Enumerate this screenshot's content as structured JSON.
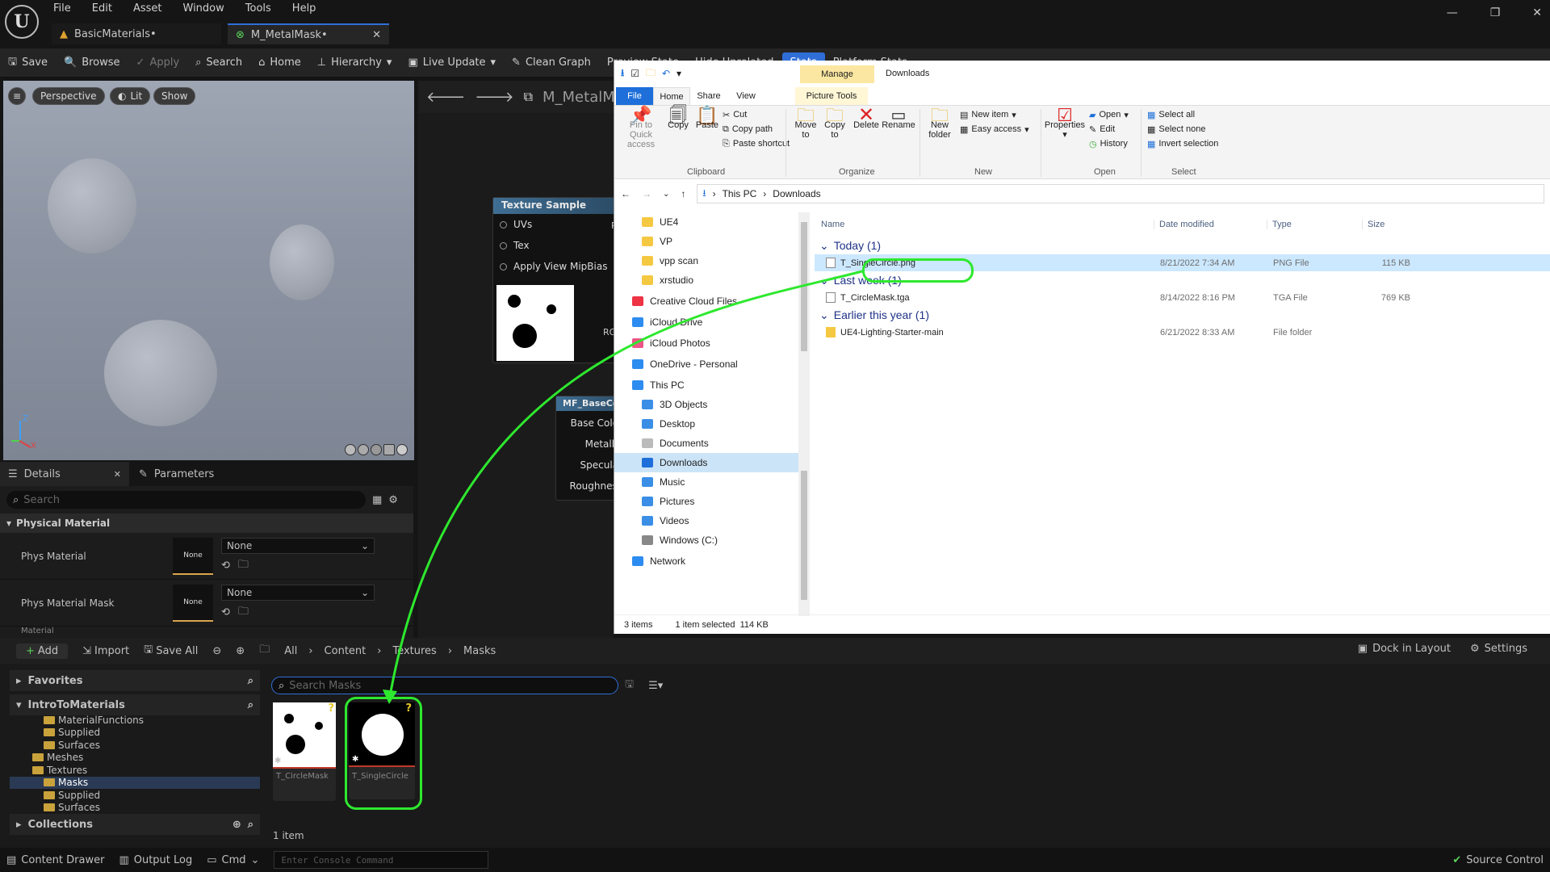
{
  "ue": {
    "menu": [
      "File",
      "Edit",
      "Asset",
      "Window",
      "Tools",
      "Help"
    ],
    "tabs": [
      {
        "label": "BasicMaterials•"
      },
      {
        "label": "M_MetalMask•"
      }
    ],
    "toolbar": {
      "save": "Save",
      "browse": "Browse",
      "apply": "Apply",
      "search": "Search",
      "home": "Home",
      "hierarchy": "Hierarchy",
      "live_update": "Live Update",
      "clean_graph": "Clean Graph",
      "preview_state": "Preview State",
      "hide_unrelated": "Hide Unrelated",
      "stats": "Stats",
      "platform_stats": "Platform Stats"
    },
    "viewport": {
      "perspective": "Perspective",
      "lit": "Lit",
      "show": "Show",
      "axis_z": "Z",
      "axis_x": "X"
    },
    "graph": {
      "title": "M_MetalMask",
      "texture_node": {
        "title": "Texture Sample",
        "pins": [
          "UVs",
          "Tex",
          "Apply View MipBias"
        ],
        "right_pin_top": "R",
        "right_pin_rgb": "RGB"
      },
      "base_node": {
        "title": "MF_BaseColor",
        "pins": [
          "Base Color",
          "Metallic",
          "Specular",
          "Roughness"
        ]
      }
    },
    "details": {
      "tab": "Details",
      "params_tab": "Parameters",
      "search_placeholder": "Search",
      "section": "Physical Material",
      "rows": [
        {
          "label": "Phys Material",
          "thumb": "None",
          "value": "None"
        },
        {
          "label": "Phys Material Mask",
          "thumb": "None",
          "value": "None"
        }
      ],
      "next_section": "Material"
    },
    "content_browser": {
      "add": "Add",
      "import": "Import",
      "save_all": "Save All",
      "breadcrumb": [
        "All",
        "Content",
        "Textures",
        "Masks"
      ],
      "dock": "Dock in Layout",
      "settings": "Settings",
      "favorites": "Favorites",
      "project": "IntroToMaterials",
      "tree": [
        {
          "label": "MaterialFunctions",
          "indent": 2
        },
        {
          "label": "Supplied",
          "indent": 2
        },
        {
          "label": "Surfaces",
          "indent": 2
        },
        {
          "label": "Meshes",
          "indent": 1
        },
        {
          "label": "Textures",
          "indent": 1
        },
        {
          "label": "Masks",
          "indent": 2,
          "selected": true
        },
        {
          "label": "Supplied",
          "indent": 2
        },
        {
          "label": "Surfaces",
          "indent": 2
        }
      ],
      "collections": "Collections",
      "search_placeholder": "Search Masks",
      "assets": [
        {
          "name": "T_CircleMask"
        },
        {
          "name": "T_SingleCircle"
        }
      ],
      "count": "1 item"
    },
    "status": {
      "content_drawer": "Content Drawer",
      "output_log": "Output Log",
      "cmd": "Cmd",
      "console_placeholder": "Enter Console Command",
      "source_control": "Source Control"
    }
  },
  "explorer": {
    "title": "Downloads",
    "manage": "Manage",
    "ribbon_tabs": [
      "File",
      "Home",
      "Share",
      "View",
      "Picture Tools"
    ],
    "clipboard": {
      "pin": "Pin to Quick access",
      "copy": "Copy",
      "paste": "Paste",
      "cut": "Cut",
      "copy_path": "Copy path",
      "paste_shortcut": "Paste shortcut",
      "label": "Clipboard"
    },
    "organize": {
      "move": "Move to",
      "copy": "Copy to",
      "delete": "Delete",
      "rename": "Rename",
      "label": "Organize"
    },
    "new": {
      "folder": "New folder",
      "item": "New item",
      "easy": "Easy access",
      "label": "New"
    },
    "open": {
      "properties": "Properties",
      "open": "Open",
      "edit": "Edit",
      "history": "History",
      "label": "Open"
    },
    "select": {
      "all": "Select all",
      "none": "Select none",
      "invert": "Invert selection",
      "label": "Select"
    },
    "address": [
      "This PC",
      "Downloads"
    ],
    "nav": [
      {
        "label": "UE4",
        "kind": "folder",
        "indent": 1
      },
      {
        "label": "VP",
        "kind": "folder",
        "indent": 1
      },
      {
        "label": "vpp scan",
        "kind": "folder",
        "indent": 1
      },
      {
        "label": "xrstudio",
        "kind": "folder",
        "indent": 1
      },
      {
        "label": "Creative Cloud Files",
        "kind": "cc",
        "indent": 0
      },
      {
        "label": "iCloud Drive",
        "kind": "cloud",
        "indent": 0
      },
      {
        "label": "iCloud Photos",
        "kind": "photos",
        "indent": 0
      },
      {
        "label": "OneDrive - Personal",
        "kind": "cloud",
        "indent": 0
      },
      {
        "label": "This PC",
        "kind": "pc",
        "indent": 0
      },
      {
        "label": "3D Objects",
        "kind": "blue",
        "indent": 1
      },
      {
        "label": "Desktop",
        "kind": "blue",
        "indent": 1
      },
      {
        "label": "Documents",
        "kind": "doc",
        "indent": 1
      },
      {
        "label": "Downloads",
        "kind": "down",
        "indent": 1,
        "selected": true
      },
      {
        "label": "Music",
        "kind": "music",
        "indent": 1
      },
      {
        "label": "Pictures",
        "kind": "blue",
        "indent": 1
      },
      {
        "label": "Videos",
        "kind": "blue",
        "indent": 1
      },
      {
        "label": "Windows (C:)",
        "kind": "drive",
        "indent": 1
      },
      {
        "label": "Network",
        "kind": "net",
        "indent": 0
      }
    ],
    "columns": [
      "Name",
      "Date modified",
      "Type",
      "Size"
    ],
    "groups": [
      {
        "label": "Today (1)",
        "files": [
          {
            "name": "T_SingleCircle.png",
            "date": "8/21/2022 7:34 AM",
            "type": "PNG File",
            "size": "115 KB",
            "selected": true
          }
        ]
      },
      {
        "label": "Last week (1)",
        "files": [
          {
            "name": "T_CircleMask.tga",
            "date": "8/14/2022 8:16 PM",
            "type": "TGA File",
            "size": "769 KB"
          }
        ]
      },
      {
        "label": "Earlier this year (1)",
        "files": [
          {
            "name": "UE4-Lighting-Starter-main",
            "date": "6/21/2022 8:33 AM",
            "type": "File folder",
            "size": "",
            "folder": true
          }
        ]
      }
    ],
    "status_items": "3 items",
    "status_selected": "1 item selected  114 KB"
  },
  "colors": {
    "highlight": "#2ee82e",
    "accent": "#2f6ed7",
    "ue_bg": "#151515"
  }
}
